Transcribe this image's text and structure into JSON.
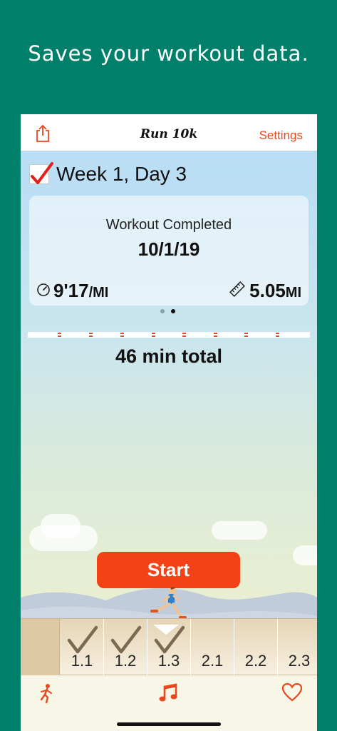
{
  "promo": {
    "headline": "Saves your workout data."
  },
  "navbar": {
    "title": "Run 10k",
    "settings_label": "Settings",
    "share_icon": "share-icon",
    "accent_color": "#e8481f"
  },
  "workout": {
    "week_day_label": "Week 1, Day 3",
    "completed": true
  },
  "card": {
    "status": "Workout Completed",
    "date": "10/1/19",
    "pace_value": "9'17",
    "pace_unit": "/MI",
    "distance_value": "5.05",
    "distance_unit": "MI",
    "pace_icon": "speedometer-icon",
    "distance_icon": "ruler-icon"
  },
  "pager": {
    "pages": 2,
    "current": 2
  },
  "timeline": {
    "total_label": "46 min total"
  },
  "start_button": {
    "label": "Start",
    "color": "#f44217"
  },
  "days": [
    {
      "label": "1.1",
      "completed": true
    },
    {
      "label": "1.2",
      "completed": true
    },
    {
      "label": "1.3",
      "completed": true,
      "selected": true
    },
    {
      "label": "2.1",
      "completed": false
    },
    {
      "label": "2.2",
      "completed": false
    },
    {
      "label": "2.3",
      "completed": false
    }
  ],
  "tabbar": {
    "items": [
      {
        "icon": "runner-icon"
      },
      {
        "icon": "music-note-icon"
      },
      {
        "icon": "heart-icon"
      }
    ]
  }
}
